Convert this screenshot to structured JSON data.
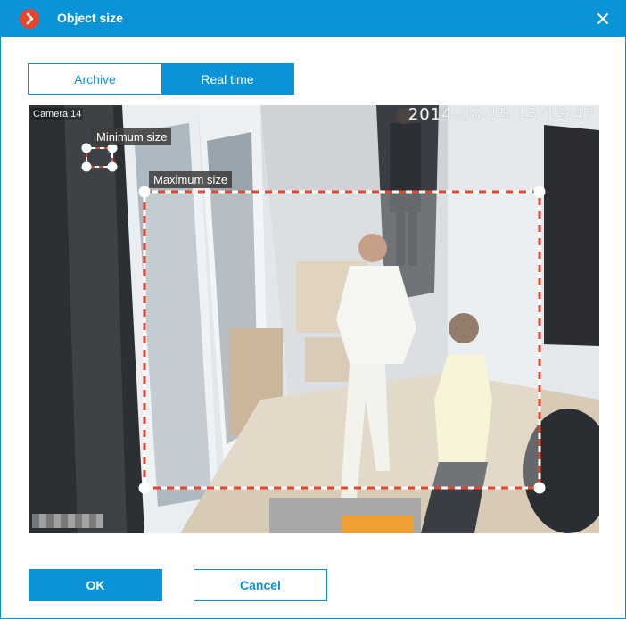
{
  "window": {
    "title": "Object size"
  },
  "tabs": [
    {
      "label": "Archive",
      "selected": false
    },
    {
      "label": "Real time",
      "selected": true
    }
  ],
  "video": {
    "camera_label": "Camera 14",
    "timestamp": "2014-08-15 15:13:47"
  },
  "regions": {
    "min_label": "Minimum size",
    "max_label": "Maximum size"
  },
  "buttons": {
    "ok": "OK",
    "cancel": "Cancel"
  },
  "colors": {
    "accent": "#0a93d6",
    "app_icon": "#e8452c",
    "region_dash": "#e8452c"
  }
}
